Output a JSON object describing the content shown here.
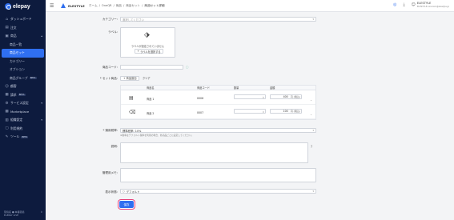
{
  "sidebar": {
    "logo": "elepay",
    "items": [
      {
        "label": "ダッシュボード",
        "icon": "home-icon",
        "sub": false,
        "active": false
      },
      {
        "label": "注文",
        "icon": "cart-icon",
        "sub": false,
        "active": false
      },
      {
        "label": "商品",
        "icon": "box-icon",
        "sub": false,
        "active": false,
        "expanded": true
      },
      {
        "label": "商品一覧",
        "sub": true,
        "active": false
      },
      {
        "label": "商品セット",
        "sub": true,
        "active": true
      },
      {
        "label": "カテゴリー",
        "sub": true,
        "active": false
      },
      {
        "label": "オプション",
        "sub": true,
        "active": false
      },
      {
        "label": "商品グループ",
        "sub": true,
        "active": false,
        "badge": "BETA"
      },
      {
        "label": "顧客",
        "icon": "user-icon",
        "sub": false,
        "active": false
      },
      {
        "label": "請求",
        "icon": "invoice-icon",
        "sub": false,
        "active": false,
        "badge": "BETA"
      },
      {
        "label": "サービス設定",
        "icon": "settings-icon",
        "sub": false,
        "active": false,
        "chevron": true
      },
      {
        "label": "Marketplace",
        "icon": "marketplace-icon",
        "sub": false,
        "active": false
      },
      {
        "label": "組織設定",
        "icon": "org-icon",
        "sub": false,
        "active": false,
        "chevron": true
      },
      {
        "label": "利用規約",
        "icon": "doc-icon",
        "sub": false,
        "active": false
      },
      {
        "label": "ツール",
        "icon": "tool-icon",
        "sub": false,
        "active": false,
        "badge": "BETA"
      }
    ],
    "footer": {
      "line1": "環境名 ● 本番環境",
      "line2": "ELEPAY LIVE"
    }
  },
  "topbar": {
    "store": "ELESTYLE",
    "breadcrumbs": [
      "ホーム",
      "OneQR",
      "商品",
      "商品セット",
      "商品セット詳細"
    ],
    "user_name": "ELESTYLE",
    "user_email": "ELESTYLE.xxxxxxx@elestyle.jp"
  },
  "form": {
    "category_label": "カテゴリー:",
    "category_placeholder": "選択してください",
    "label_label": "ラベル:",
    "label_empty": "ラベルが設定されていません",
    "label_button": "ラベルを選択する",
    "code_label": "商品コード:",
    "set_label": "* セット商品:",
    "add_product": "商品追加",
    "clear": "クリア",
    "table": {
      "headers": [
        "商品名",
        "商品コード",
        "数量",
        "金額"
      ],
      "rows": [
        {
          "image": "product-image-icon",
          "name": "商品 1",
          "code": "0006",
          "price": "400",
          "unit": "円 (税込)"
        },
        {
          "image": "trash-product-icon",
          "name": "商品 2",
          "code": "0007",
          "price": "100",
          "unit": "円 (税込)"
        }
      ]
    },
    "tax_label": "* 適用税率:",
    "tax_value": "標準税率: 10%",
    "tax_hint": "※税率はデフォルト税率を利用の場合、各商品ごとに設定してください。",
    "description_label": "説明:",
    "memo_label": "管理用メモ:",
    "status_label": "表示状態:",
    "status_value": "デフォルト",
    "save_button": "保存"
  },
  "colors": {
    "sidebar_bg": "#0d1b3e",
    "accent": "#2f6ff0",
    "focus_ring": "#e8417a",
    "success": "#2aa57a"
  }
}
